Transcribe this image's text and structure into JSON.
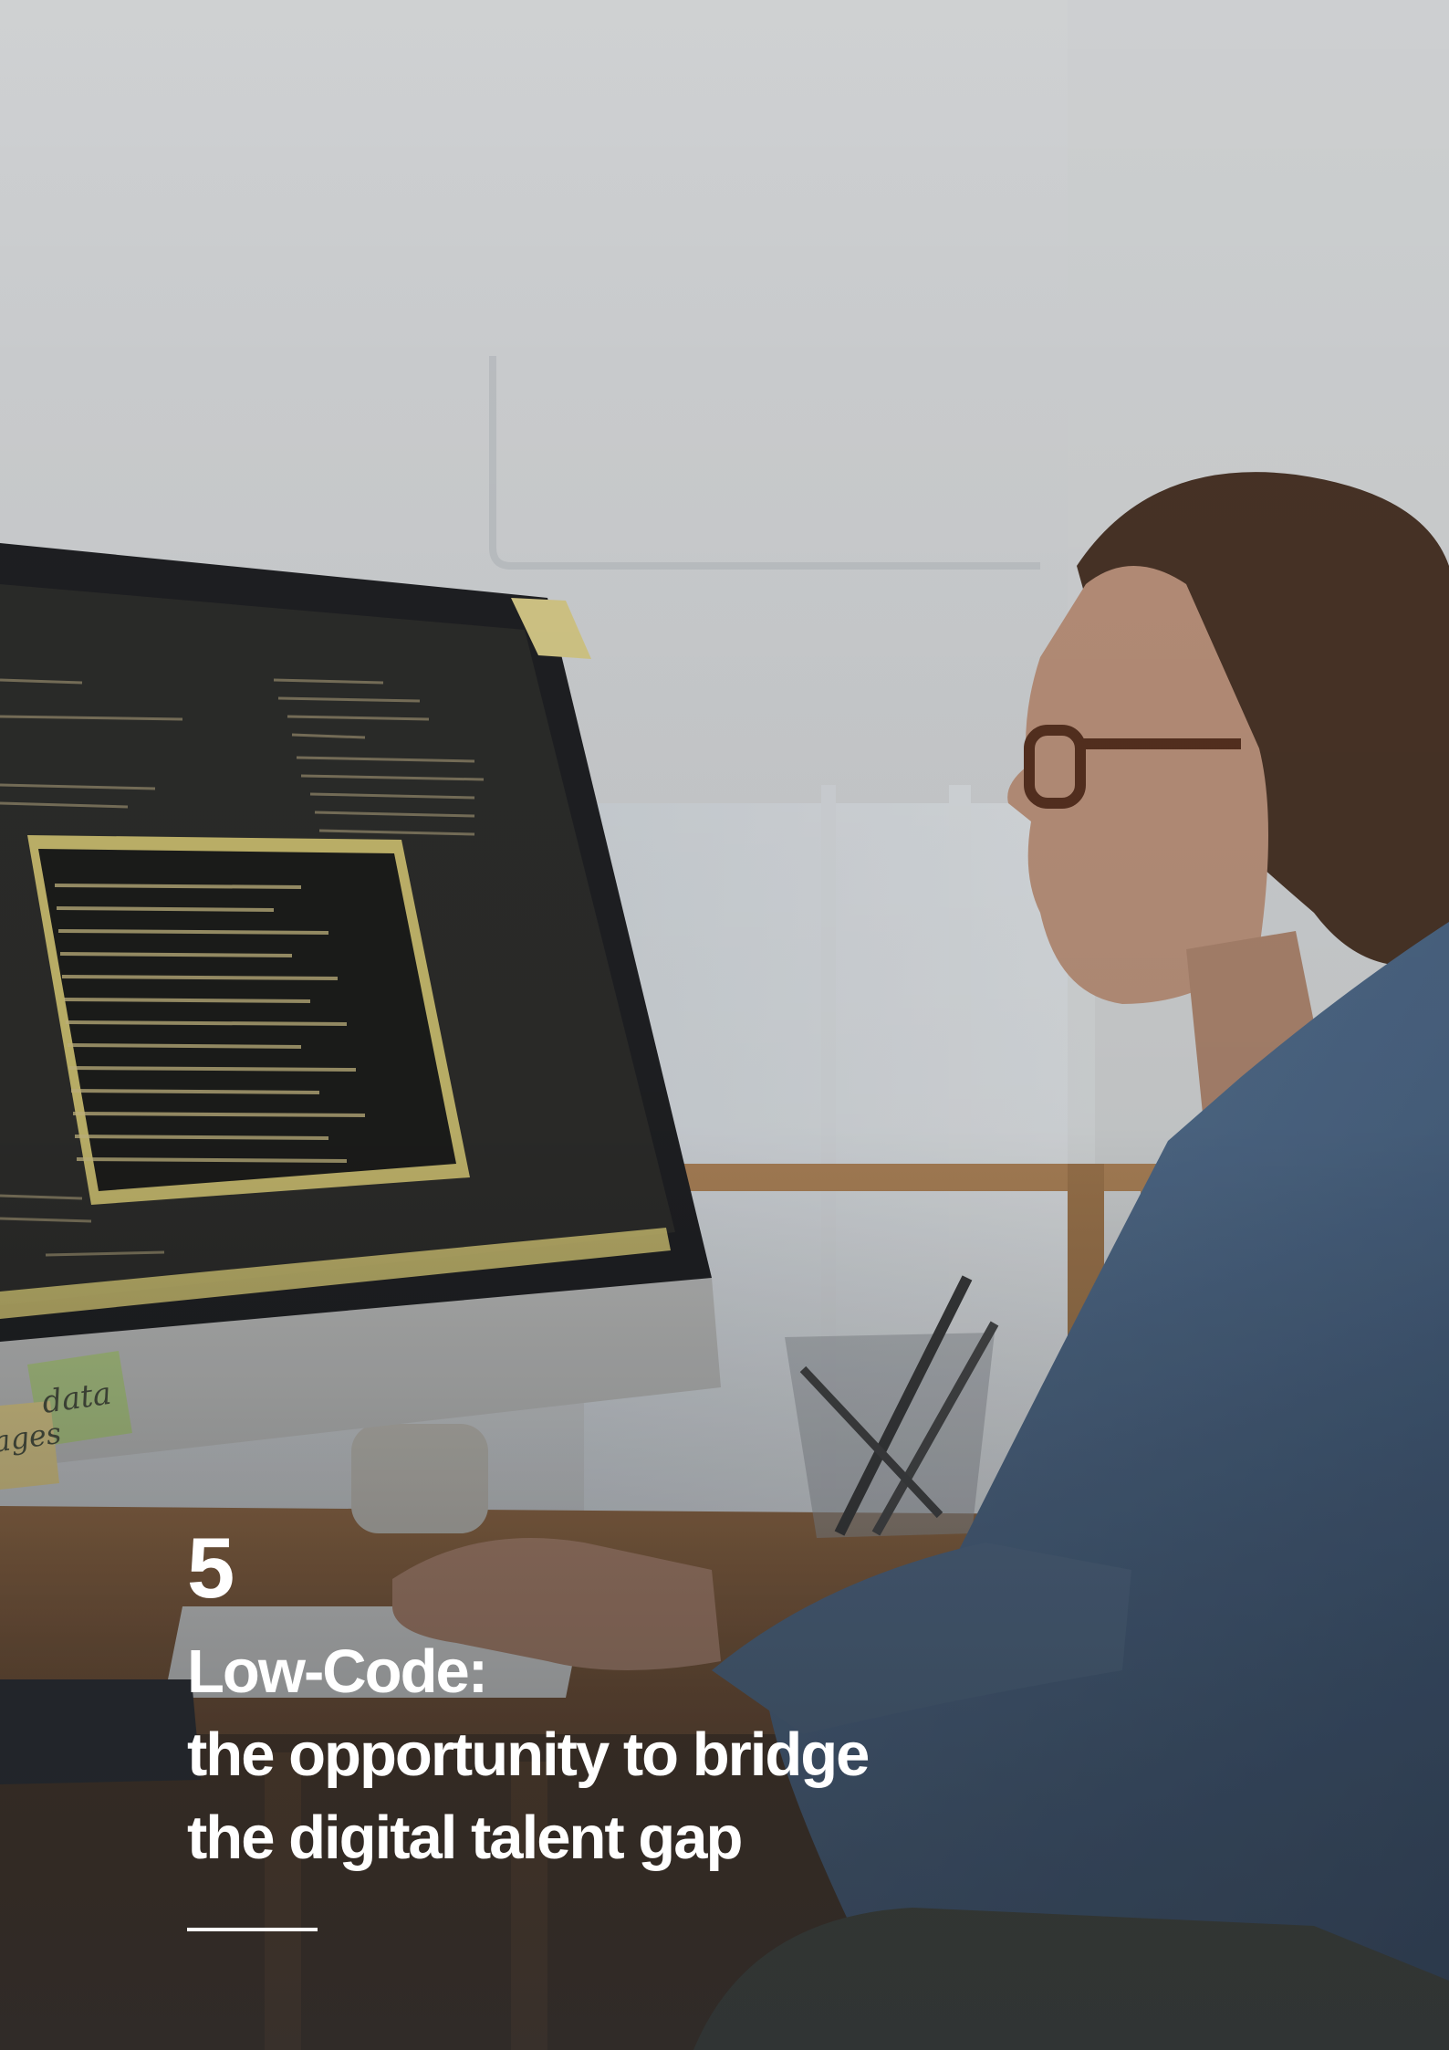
{
  "chapter": {
    "number": "5",
    "title_lines": [
      "Low-Code:",
      "the opportunity to bridge",
      "the digital talent gap"
    ]
  },
  "photo": {
    "sticky_notes": [
      "data",
      "ages"
    ],
    "colors": {
      "overlay_tint": "#2b2f36",
      "monitor_highlight": "#e8d77a",
      "shirt": "#4d6a8c",
      "wood": "#b98a5a"
    }
  }
}
